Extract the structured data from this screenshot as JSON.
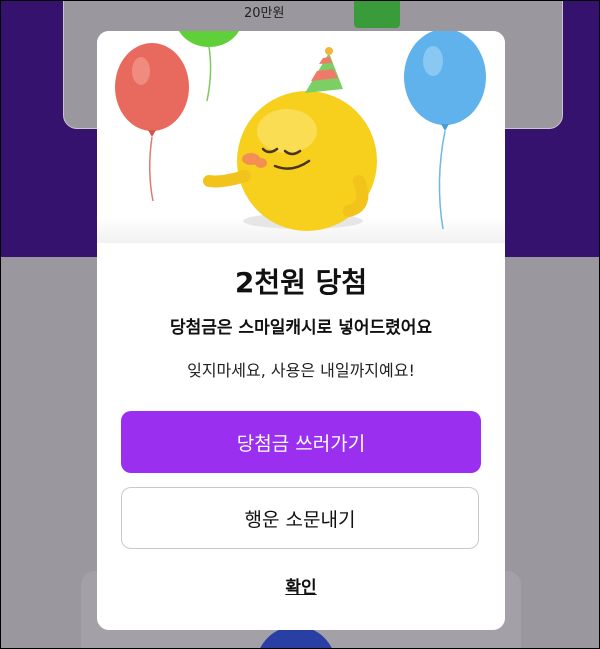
{
  "background": {
    "top_card_amount": "20만원"
  },
  "modal": {
    "title": "2천원 당첨",
    "subtitle": "당첨금은 스마일캐시로 넣어드렸어요",
    "note": "잊지마세요, 사용은 내일까지예요!",
    "primary_button": "당첨금 쓰러가기",
    "secondary_button": "행운 소문내기",
    "confirm_link": "확인"
  },
  "colors": {
    "accent": "#9a2ff0",
    "background_purple": "#35126e",
    "dim_overlay": "#9a979f"
  },
  "illustration": {
    "icons": [
      "red-balloon-icon",
      "green-balloon-icon",
      "blue-balloon-icon",
      "party-character-icon",
      "party-hat-icon"
    ]
  }
}
